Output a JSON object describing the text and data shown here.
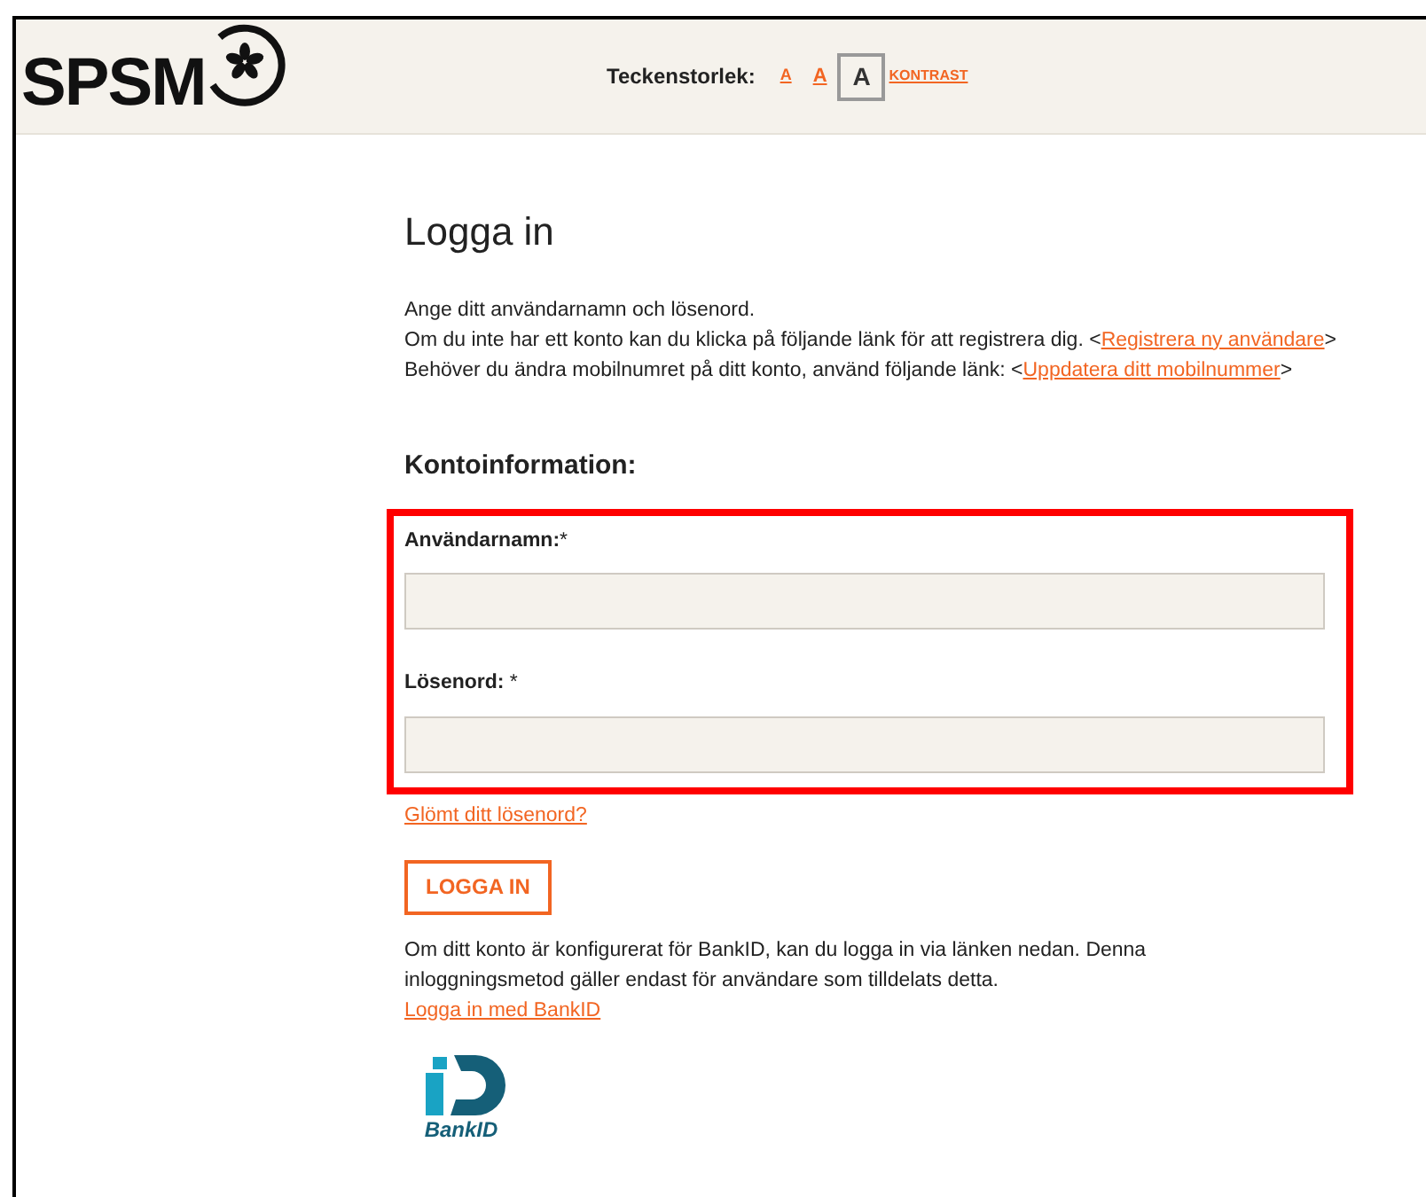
{
  "header": {
    "logo": "SPSM",
    "font_size_label": "Teckenstorlek:",
    "font_sizes": [
      {
        "label": "A",
        "selected": false
      },
      {
        "label": "A",
        "selected": false
      },
      {
        "label": "A",
        "selected": true
      }
    ],
    "contrast_link": "KONTRAST"
  },
  "title": "Logga in",
  "intro": [
    {
      "text": "Ange ditt användarnamn och lösenord."
    },
    {
      "text": "Om du inte har ett konto kan du klicka på följande länk för att registrera dig. <",
      "link": "Registrera ny användare",
      "after": ">"
    },
    {
      "text": "Behöver du ändra mobilnumret på ditt konto, använd följande länk: <",
      "link": "Uppdatera ditt mobilnummer",
      "after": ">"
    }
  ],
  "section_heading": "Kontoinformation:",
  "fields": [
    {
      "label": "Användarnamn:",
      "required": "*"
    },
    {
      "label": "Lösenord: ",
      "required": "*"
    }
  ],
  "forgot_link": "Glömt ditt lösenord?",
  "login_button": "LOGGA IN",
  "bankid_text": "Om ditt konto är konfigurerat för BankID, kan du logga in via länken nedan. Denna inloggningsmetod gäller endast för användare som tilldelats detta.",
  "bankid_link": "Logga in med BankID",
  "bankid_logo": "BankID"
}
